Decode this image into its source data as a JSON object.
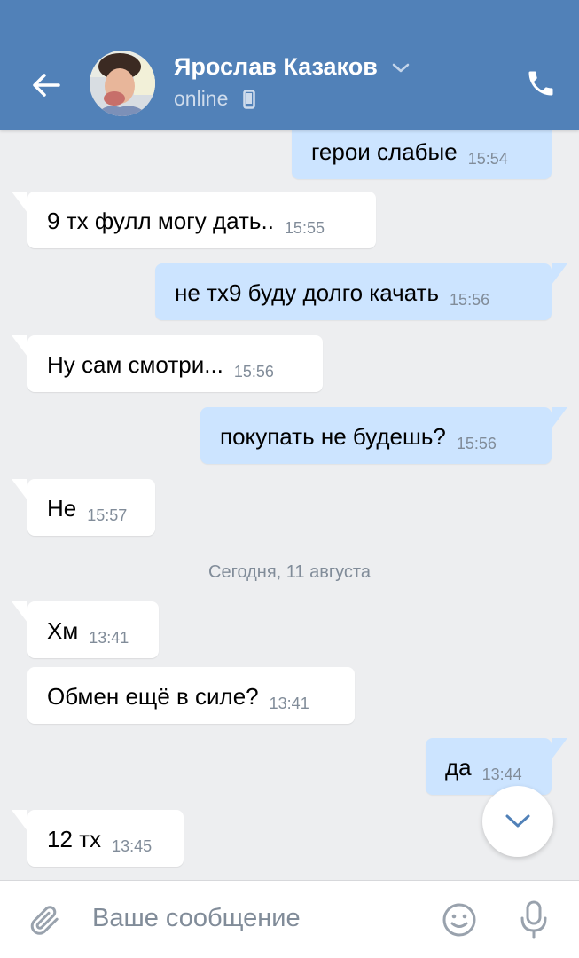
{
  "header": {
    "contact_name": "Ярослав Казаков",
    "status": "online",
    "icons": {
      "back": "arrow-left-icon",
      "name_dropdown": "chevron-down-icon",
      "device": "phone-device-icon",
      "call": "phone-call-icon"
    },
    "colors": {
      "background": "#5181b8",
      "text": "#ffffff",
      "status": "#cfdcec"
    }
  },
  "chat": {
    "colors": {
      "background": "#edeef0",
      "incoming": "#ffffff",
      "outgoing": "#cce4ff",
      "time": "#818c99"
    },
    "messages": [
      {
        "direction": "out",
        "text": "герои слабые",
        "time": "15:54"
      },
      {
        "direction": "in",
        "text": "9 тх фулл могу дать..",
        "time": "15:55"
      },
      {
        "direction": "out",
        "text": "не тх9 буду долго качать",
        "time": "15:56"
      },
      {
        "direction": "in",
        "text": "Ну сам смотри...",
        "time": "15:56"
      },
      {
        "direction": "out",
        "text": "покупать не будешь?",
        "time": "15:56"
      },
      {
        "direction": "in",
        "text": "Не",
        "time": "15:57"
      },
      {
        "direction": "in",
        "text": "Хм",
        "time": "13:41"
      },
      {
        "direction": "in",
        "text": "Обмен ещё в силе?",
        "time": "13:41"
      },
      {
        "direction": "out",
        "text": "да",
        "time": "13:44"
      },
      {
        "direction": "in",
        "text": "12 тх",
        "time": "13:45"
      }
    ],
    "date_separator": "Сегодня, 11 августа",
    "scroll_button_icon": "chevron-down-icon"
  },
  "composer": {
    "placeholder": "Ваше сообщение",
    "value": "",
    "icons": {
      "attach": "paperclip-icon",
      "emoji": "smiley-icon",
      "voice": "microphone-icon"
    }
  }
}
